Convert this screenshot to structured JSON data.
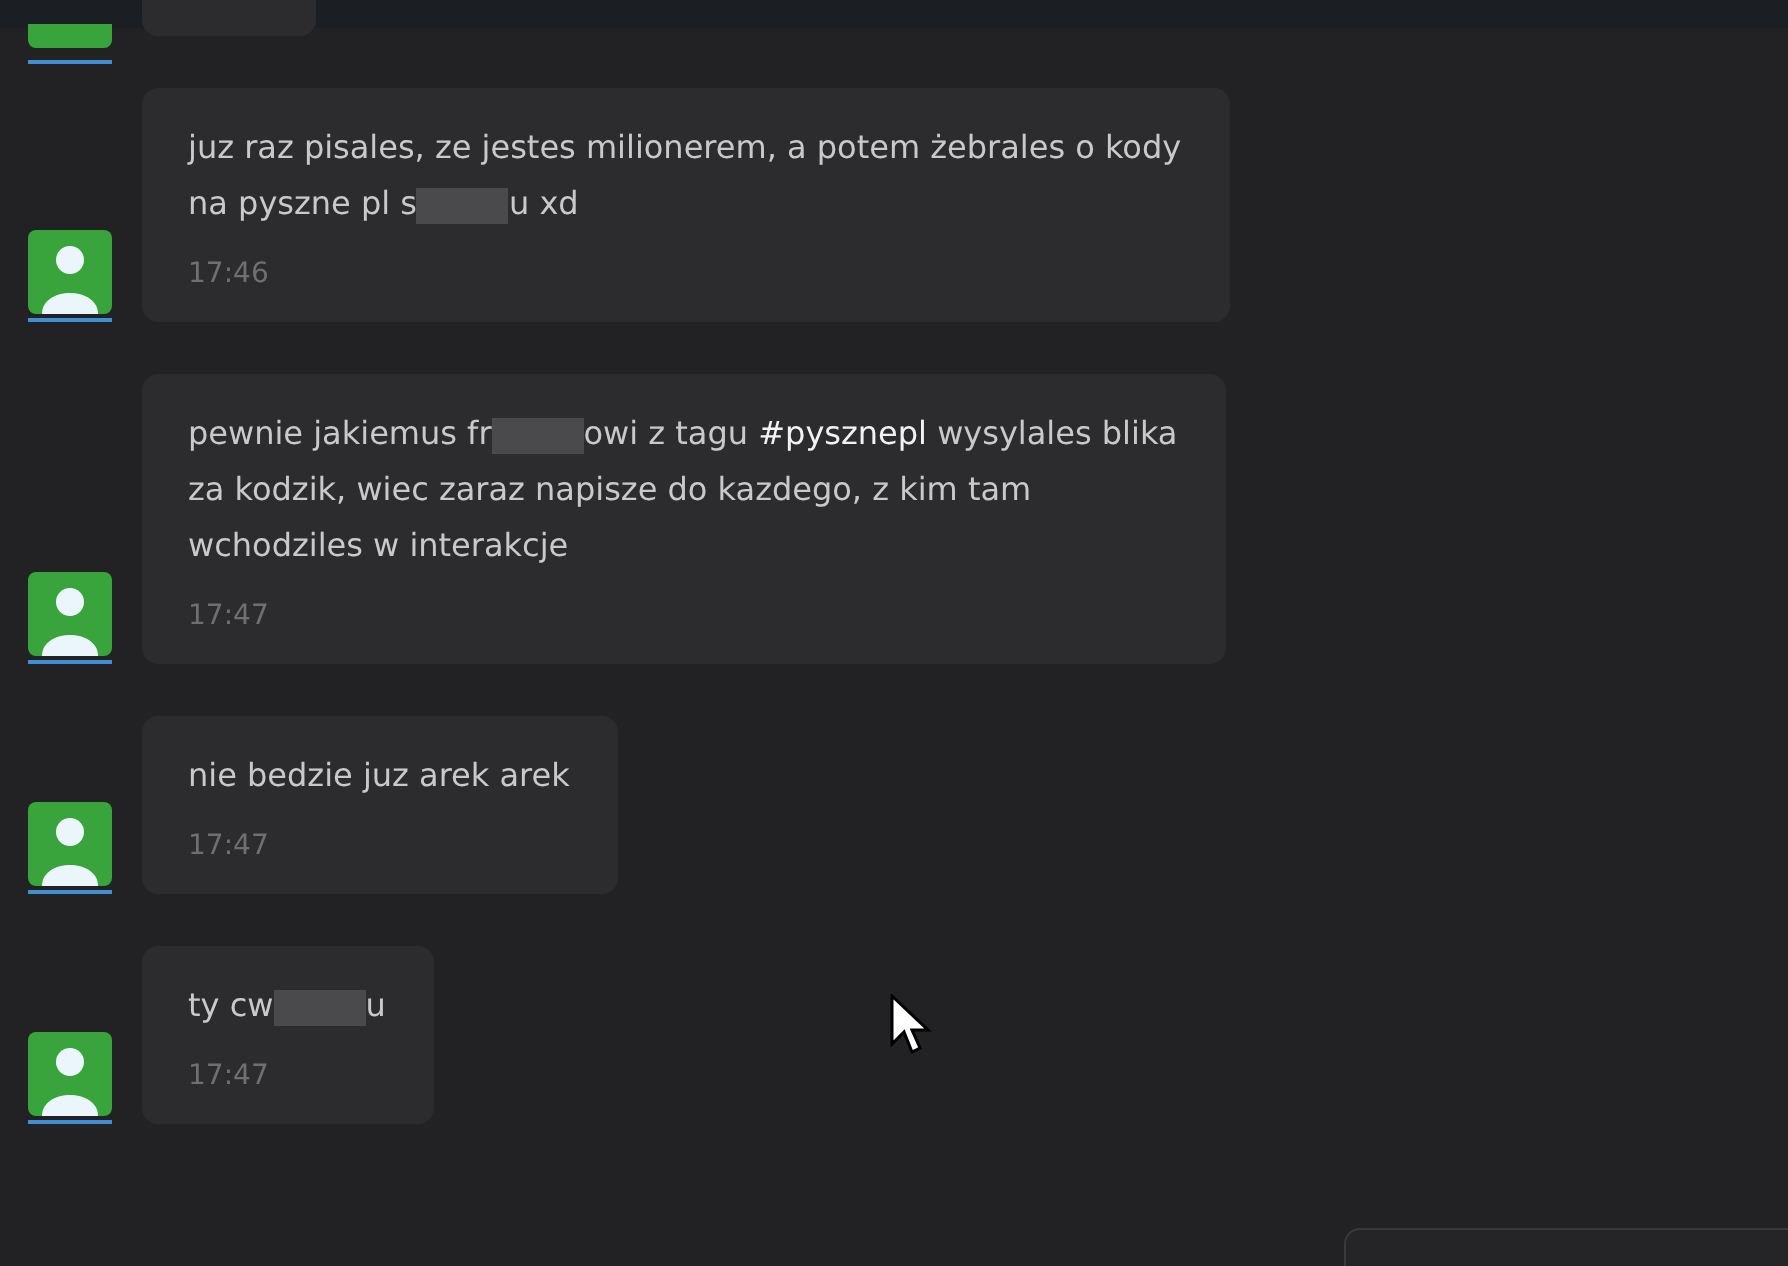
{
  "messages": [
    {
      "lines": [
        [
          {
            "kind": "text",
            "text": "juz raz pisales, ze jestes milionerem, a potem żebrales o kody"
          }
        ],
        [
          {
            "kind": "text",
            "text": "na pyszne pl s"
          },
          {
            "kind": "redacted"
          },
          {
            "kind": "text",
            "text": "u xd"
          }
        ]
      ],
      "time": "17:46"
    },
    {
      "lines": [
        [
          {
            "kind": "text",
            "text": "pewnie jakiemus fr"
          },
          {
            "kind": "redacted"
          },
          {
            "kind": "text",
            "text": "owi z tagu "
          },
          {
            "kind": "tag",
            "text": "#pysznepl"
          },
          {
            "kind": "text",
            "text": " wysylales blika"
          }
        ],
        [
          {
            "kind": "text",
            "text": "za kodzik, wiec zaraz napisze do kazdego, z kim tam"
          }
        ],
        [
          {
            "kind": "text",
            "text": "wchodziles w interakcje"
          }
        ]
      ],
      "time": "17:47"
    },
    {
      "lines": [
        [
          {
            "kind": "text",
            "text": "nie bedzie juz arek arek"
          }
        ]
      ],
      "time": "17:47"
    },
    {
      "lines": [
        [
          {
            "kind": "text",
            "text": "ty cw"
          },
          {
            "kind": "redacted"
          },
          {
            "kind": "text",
            "text": "u"
          }
        ]
      ],
      "time": "17:47"
    }
  ]
}
